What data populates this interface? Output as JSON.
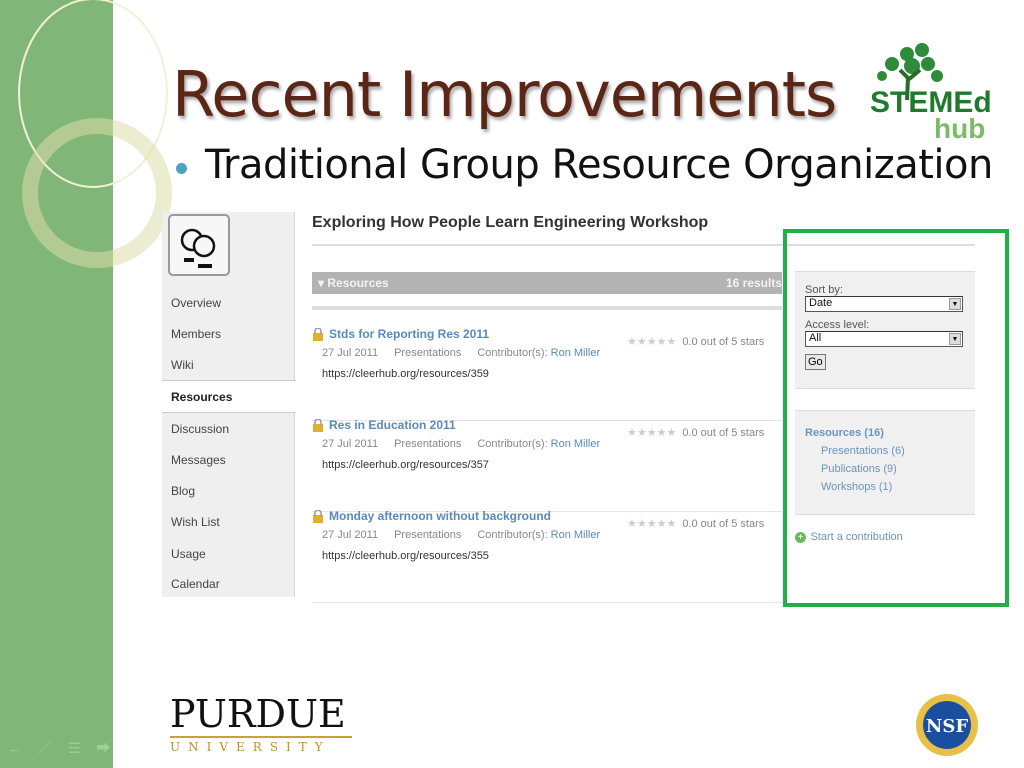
{
  "slide": {
    "title": "Recent Improvements",
    "bullet": "Traditional Group Resource Organization",
    "logos": {
      "stemed": "STEMEd hub",
      "purdue": "PURDUE",
      "purdue_sub": "UNIVERSITY",
      "nsf": "NSF"
    }
  },
  "colors": {
    "band": "#80b677",
    "title": "#5b2616",
    "highlight": "#1fb04c",
    "link": "#5a8ab8"
  },
  "group": {
    "nav": [
      "Overview",
      "Members",
      "Wiki",
      "Resources",
      "Discussion",
      "Messages",
      "Blog",
      "Wish List",
      "Usage",
      "Calendar"
    ],
    "active": "Resources",
    "title": "Exploring How People Learn Engineering Workshop",
    "resources_label": "Resources",
    "results": "16 results",
    "items": [
      {
        "title": "Stds for Reporting Res 2011",
        "date": "27 Jul 2011",
        "type": "Presentations",
        "contrib_label": "Contributor(s):",
        "contributor": "Ron Miller",
        "url": "https://cleerhub.org/resources/359",
        "rating": "0.0 out of 5 stars"
      },
      {
        "title": "Res in Education 2011",
        "date": "27 Jul 2011",
        "type": "Presentations",
        "contrib_label": "Contributor(s):",
        "contributor": "Ron Miller",
        "url": "https://cleerhub.org/resources/357",
        "rating": "0.0 out of 5 stars"
      },
      {
        "title": "Monday afternoon without background",
        "date": "27 Jul 2011",
        "type": "Presentations",
        "contrib_label": "Contributor(s):",
        "contributor": "Ron Miller",
        "url": "https://cleerhub.org/resources/355",
        "rating": "0.0 out of 5 stars"
      }
    ],
    "filters": {
      "sort_label": "Sort by:",
      "sort_value": "Date",
      "access_label": "Access level:",
      "access_value": "All",
      "go": "Go"
    },
    "categories": {
      "main": "Resources (16)",
      "sub": [
        "Presentations (6)",
        "Publications (9)",
        "Workshops (1)"
      ]
    },
    "start": "Start a contribution"
  }
}
